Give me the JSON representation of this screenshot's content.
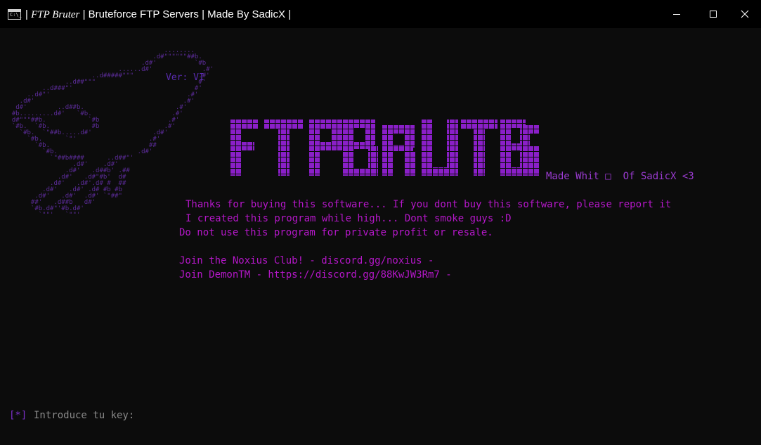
{
  "window": {
    "title_prefix": "|",
    "title_italic": "FTP Bruter",
    "title_rest": "| Bruteforce FTP Servers | Made By SadicX |",
    "icon_label": "C:\\_"
  },
  "console": {
    "version": "Ver: VI",
    "logo_text": "FTP BRUTER",
    "made_by": "Made Whit □  Of SadicX <3",
    "lines": [
      "Thanks for buying this software... If you dont buy this software, please report it",
      "I created this program while high... Dont smoke guys :D",
      "Do not use this program for private profit or resale.",
      "Join the Noxius Club! - discord.gg/noxius -",
      "Join DemonTM - https://discord.gg/88KwJW3Rm7 -"
    ],
    "prompt_marker": "[*]",
    "prompt_text": "Introduce tu key:"
  },
  "colors": {
    "background": "#0c0c0c",
    "text_magenta": "#b517c9",
    "logo_purple": "#8a1fc8",
    "ascii_purple": "#5a2b96"
  }
}
